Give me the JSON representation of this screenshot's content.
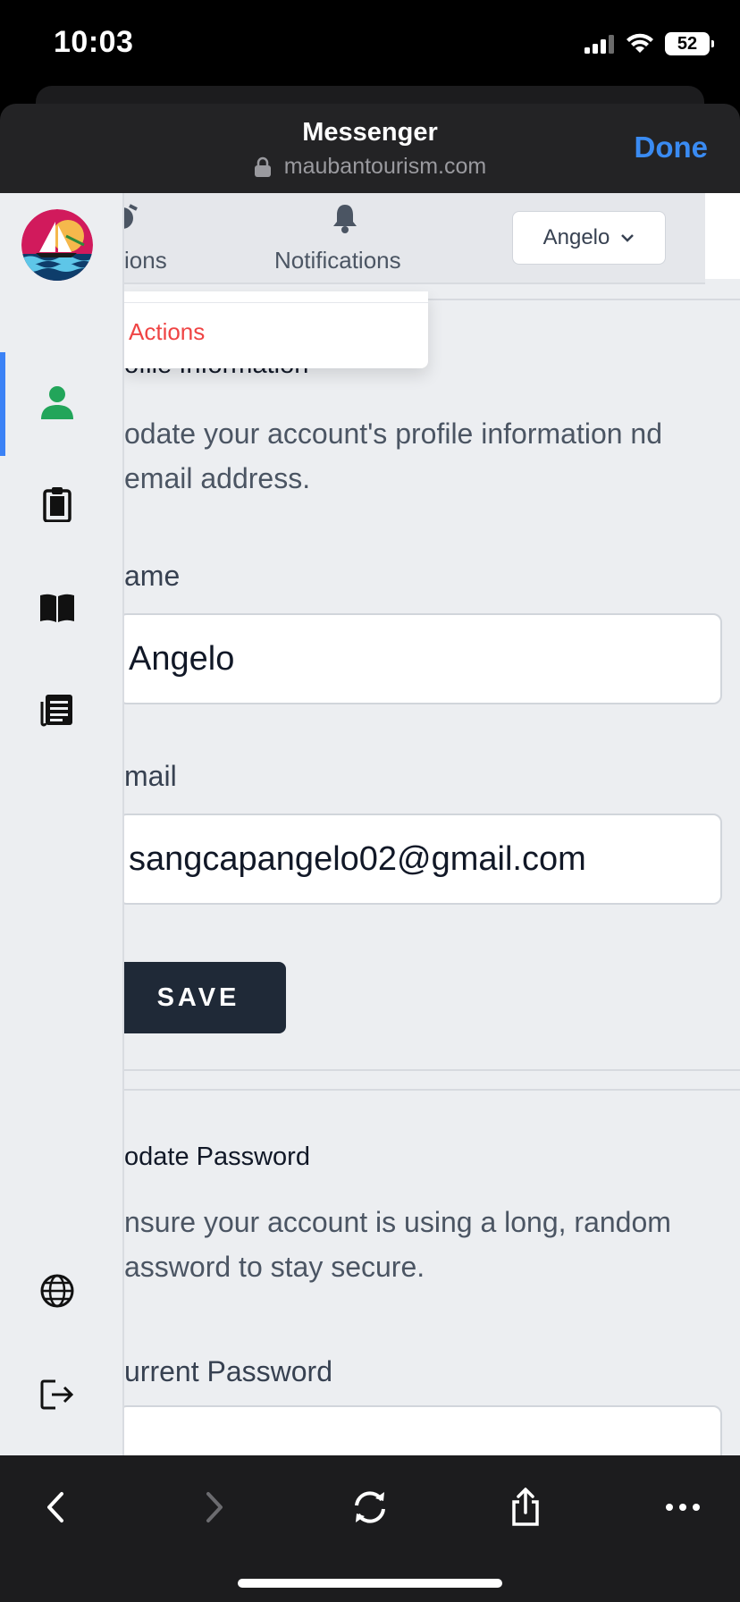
{
  "status_bar": {
    "time": "10:03",
    "battery": "52"
  },
  "browser": {
    "title": "Messenger",
    "url": "maubantourism.com",
    "done_label": "Done"
  },
  "topnav": {
    "partial_label": "ions",
    "notifications_label": "Notifications",
    "user_name": "Angelo"
  },
  "actions_menu": {
    "item": "Actions"
  },
  "profile": {
    "title": "ofile Information",
    "description": "odate your account's profile information nd email address.",
    "name_label": "ame",
    "name_value": "Angelo",
    "email_label": "mail",
    "email_value": "sangcapangelo02@gmail.com",
    "save_label": "SAVE"
  },
  "password": {
    "title": "odate Password",
    "description": "nsure your account is using a long, random assword to stay secure.",
    "current_label": "urrent Password"
  },
  "colors": {
    "accent": "#3b82f6",
    "done": "#3a8bf2",
    "danger": "#ef4444",
    "button_dark": "#1f2937",
    "active_icon": "#22a55a"
  },
  "icons": {
    "sidebar": [
      "person-icon",
      "clipboard-icon",
      "book-icon",
      "list-document-icon",
      "globe-icon",
      "logout-icon"
    ],
    "toolbar": [
      "back-icon",
      "forward-icon",
      "refresh-icon",
      "share-icon",
      "more-icon"
    ]
  }
}
